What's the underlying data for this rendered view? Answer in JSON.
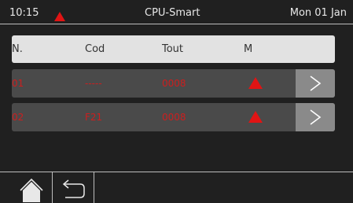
{
  "status_bar": {
    "time": "10:15",
    "alarm_icon": "warning-triangle-icon",
    "title": "CPU-Smart",
    "date": "Mon 01 Jan"
  },
  "table": {
    "headers": [
      "N.",
      "Cod",
      "Tout",
      "M"
    ],
    "rows": [
      {
        "n": "01",
        "cod": "-----",
        "tout": "0008",
        "m_icon": "warning-triangle-icon",
        "action_icon": "chevron-right-icon"
      },
      {
        "n": "02",
        "cod": "F21",
        "tout": "0008",
        "m_icon": "warning-triangle-icon",
        "action_icon": "chevron-right-icon"
      }
    ]
  },
  "nav": {
    "home_icon": "home-icon",
    "back_icon": "back-arrow-icon"
  },
  "colors": {
    "background": "#202020",
    "header_row": "#e2e2e2",
    "data_row": "#4a4a4a",
    "alarm_red": "#e01414",
    "value_red": "#cc1e1e",
    "goto_button": "#8a8a8a"
  }
}
